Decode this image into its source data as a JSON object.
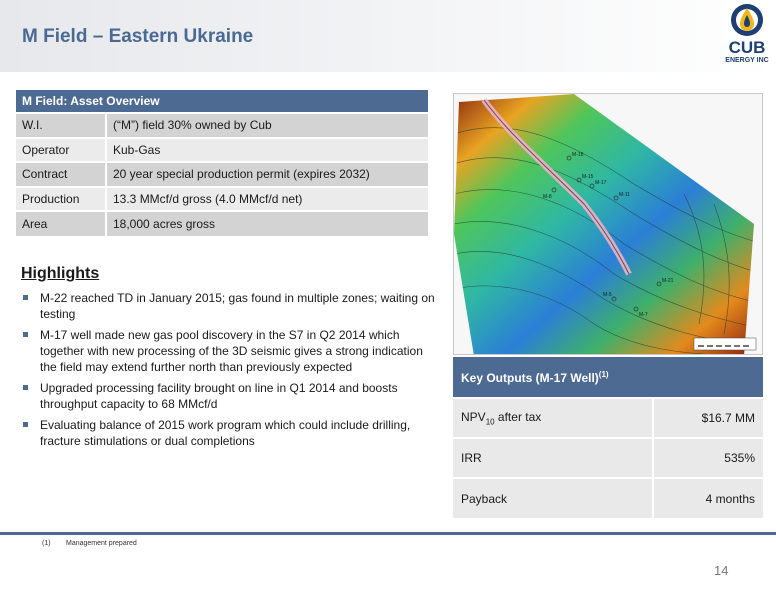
{
  "page": {
    "title": "M Field – Eastern Ukraine",
    "number": "14"
  },
  "logo": {
    "name": "CUB",
    "subtitle": "ENERGY INC",
    "colors": {
      "primary": "#1d3f74",
      "accent": "#f2b51e"
    }
  },
  "asset_overview": {
    "heading": "M Field: Asset Overview",
    "rows": [
      {
        "label": "W.I.",
        "value": "(“M”) field 30% owned by Cub"
      },
      {
        "label": "Operator",
        "value": "Kub-Gas"
      },
      {
        "label": "Contract",
        "value": "20 year special production permit (expires 2032)"
      },
      {
        "label": "Production",
        "value": "13.3 MMcf/d gross (4.0 MMcf/d net)"
      },
      {
        "label": "Area",
        "value": "18,000 acres gross"
      }
    ]
  },
  "highlights": {
    "title": "Highlights",
    "items": [
      "M-22 reached TD in January 2015; gas found in multiple zones; waiting on testing",
      "M-17 well made new gas pool discovery in the S7 in Q2 2014 which together with new processing of the 3D seismic gives a strong indication the field may extend further north than previously expected",
      "Upgraded processing facility brought on line in Q1 2014 and boosts throughput capacity to 68 MMcf/d",
      "Evaluating balance of 2015 work program which could include drilling, fracture stimulations or dual completions"
    ]
  },
  "key_outputs": {
    "heading": "Key Outputs (M-17 Well)",
    "heading_note": "(1)",
    "rows": [
      {
        "label": "NPV",
        "label_sub": "10",
        "label_suffix": " after tax",
        "value": "$16.7 MM"
      },
      {
        "label": "IRR",
        "label_sub": "",
        "label_suffix": "",
        "value": "535%"
      },
      {
        "label": "Payback",
        "label_sub": "",
        "label_suffix": "",
        "value": "4 months"
      }
    ]
  },
  "map": {
    "well_labels": [
      "M-16",
      "M-15",
      "M-17",
      "M-8",
      "M-11",
      "M-21",
      "M-5",
      "M-7"
    ]
  },
  "footnote": {
    "number": "(1)",
    "text": "Management prepared"
  },
  "theme": {
    "header_blue": "#4d6b92",
    "title_blue": "#4a6a94"
  }
}
